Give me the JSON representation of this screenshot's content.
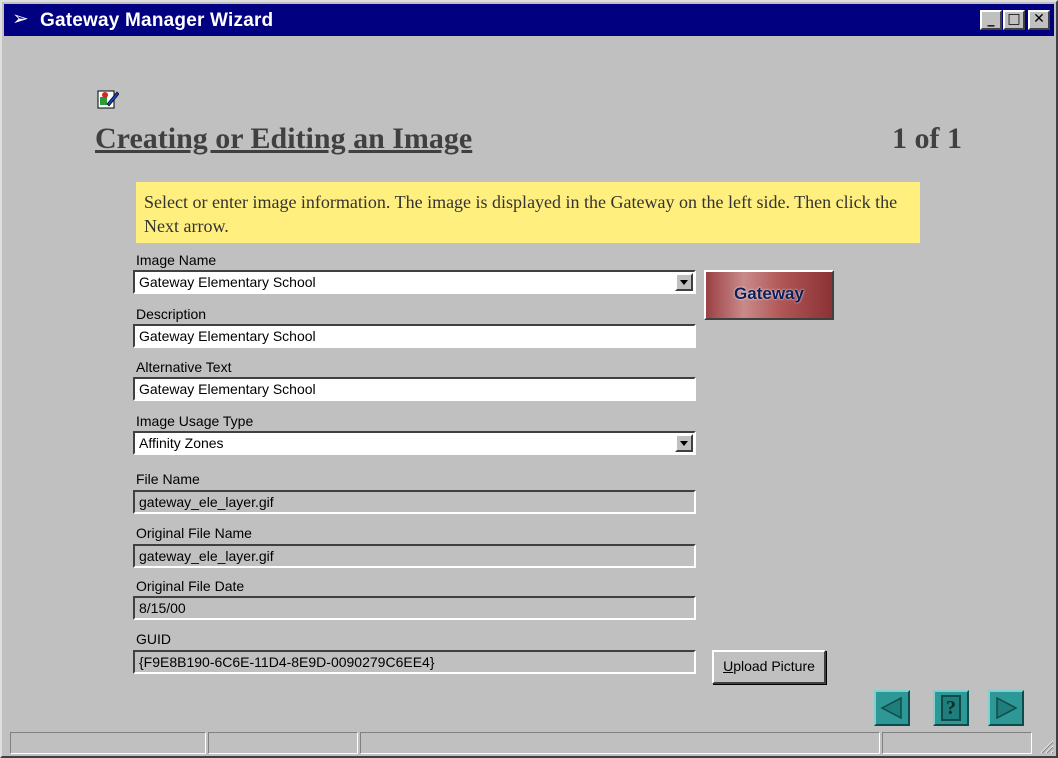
{
  "window": {
    "title": "Gateway Manager Wizard",
    "icon": "arrow-icon",
    "controls": {
      "minimize": "_",
      "maximize": "□",
      "close": "✕"
    }
  },
  "page": {
    "title": "Creating or Editing an Image",
    "counter": "1 of 1",
    "instructions": "Select or enter image information. The image is displayed in the Gateway on the left side. Then click the Next arrow."
  },
  "form": {
    "image_name": {
      "label": "Image Name",
      "value": "Gateway Elementary School"
    },
    "description": {
      "label": "Description",
      "value": "Gateway Elementary School"
    },
    "alt_text": {
      "label": "Alternative Text",
      "value": "Gateway Elementary School"
    },
    "usage_type": {
      "label": "Image Usage Type",
      "value": "Affinity Zones"
    },
    "file_name": {
      "label": "File Name",
      "value": "gateway_ele_layer.gif"
    },
    "original_file_name": {
      "label": "Original File Name",
      "value": "gateway_ele_layer.gif"
    },
    "original_file_date": {
      "label": "Original File Date",
      "value": "8/15/00"
    },
    "guid": {
      "label": "GUID",
      "value": "{F9E8B190-6C6E-11D4-8E9D-0090279C6EE4}"
    }
  },
  "preview": {
    "text": "Gateway"
  },
  "buttons": {
    "upload_underlined": "U",
    "upload_rest": "pload Picture",
    "help": "?"
  },
  "colors": {
    "titlebar": "#000080",
    "window_bg": "#c0c0c0",
    "instructions_bg": "#ffef7f",
    "nav_button": "#2e9896"
  }
}
